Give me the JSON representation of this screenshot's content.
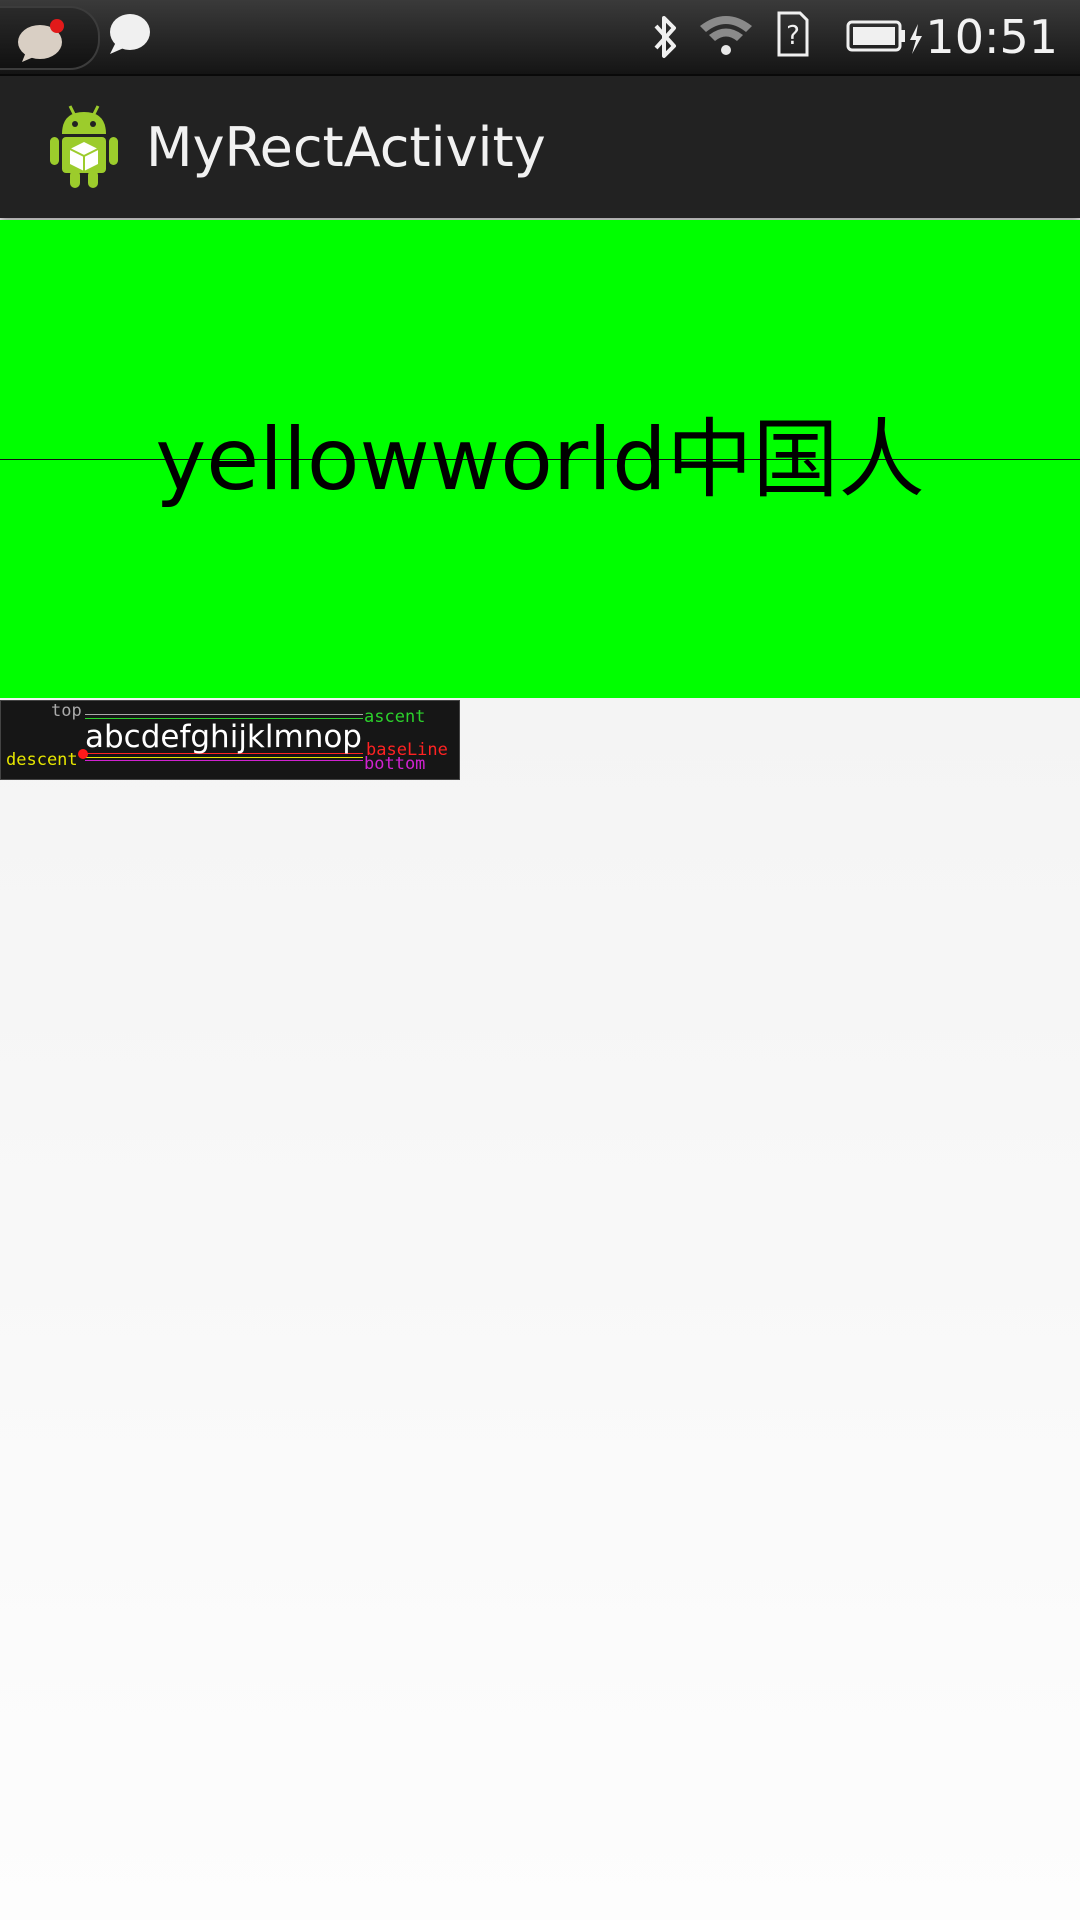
{
  "status_bar": {
    "time": "10:51",
    "icons": [
      "chat-notification-icon",
      "speech-bubble-icon",
      "bluetooth-icon",
      "wifi-icon",
      "sim-card-unknown-icon",
      "battery-charging-icon"
    ]
  },
  "action_bar": {
    "title": "MyRectActivity",
    "icon": "android-app-icon"
  },
  "canvas_view": {
    "background": "#00ff00",
    "text": "yellowworld中国人"
  },
  "metrics_view": {
    "sample_text": "abcdefghijklmnop",
    "labels": {
      "top": "top",
      "ascent": "ascent",
      "baseline": "baseLine",
      "bottom": "bottom",
      "descent": "descent"
    },
    "colors": {
      "top": "#aaaaaa",
      "ascent": "#2bd12b",
      "baseline": "#ff2222",
      "bottom": "#d022d0",
      "descent": "#e6e600"
    }
  }
}
